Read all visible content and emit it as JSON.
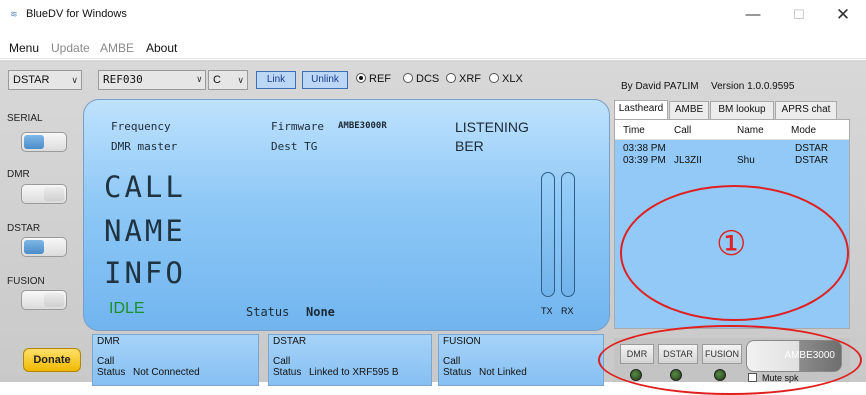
{
  "window": {
    "title": "BlueDV for Windows",
    "minimize": "—",
    "maximize": "☐",
    "close": "✕"
  },
  "menu": [
    "Menu",
    "Update",
    "AMBE",
    "About"
  ],
  "toolbar": {
    "mode_select": "DSTAR",
    "reflector_select": "REF030",
    "module_select": "C",
    "link_label": "Link",
    "unlink_label": "Unlink",
    "radios": [
      {
        "label": "REF",
        "selected": true
      },
      {
        "label": "DCS",
        "selected": false
      },
      {
        "label": "XRF",
        "selected": false
      },
      {
        "label": "XLX",
        "selected": false
      }
    ],
    "author": "By David PA7LIM",
    "version": "Version 1.0.0.9595"
  },
  "modes": [
    {
      "label": "SERIAL",
      "on": true
    },
    {
      "label": "DMR",
      "on": false
    },
    {
      "label": "DSTAR",
      "on": true
    },
    {
      "label": "FUSION",
      "on": false
    }
  ],
  "lcd": {
    "frequency_label": "Frequency",
    "dmr_master_label": "DMR master",
    "firmware_label": "Firmware",
    "firmware_value": "AMBE3000R",
    "dest_tg_label": "Dest TG",
    "listening": "LISTENING",
    "ber": "BER",
    "call": "CALL",
    "name": "NAME",
    "info": "INFO",
    "state": "IDLE",
    "status_label": "Status",
    "status_value": "None",
    "tx": "TX",
    "rx": "RX"
  },
  "bottom_panels": [
    {
      "title": "DMR",
      "call_label": "Call",
      "status_label": "Status",
      "status_value": "Not Connected"
    },
    {
      "title": "DSTAR",
      "call_label": "Call",
      "status_label": "Status",
      "status_value": "Linked to XRF595 B"
    },
    {
      "title": "FUSION",
      "call_label": "Call",
      "status_label": "Status",
      "status_value": "Not Linked"
    }
  ],
  "donate_label": "Donate",
  "tabs": [
    "Lastheard",
    "AMBE",
    "BM lookup",
    "APRS chat"
  ],
  "lastheard": {
    "columns": [
      "Time",
      "Call",
      "Name",
      "Mode"
    ],
    "rows": [
      {
        "time": "03:38 PM",
        "call": "",
        "name": "",
        "mode": "DSTAR"
      },
      {
        "time": "03:39 PM",
        "call": "JL3ZII",
        "name": "Shu",
        "mode": "DSTAR"
      }
    ]
  },
  "ambe_panel": {
    "buttons": [
      "DMR",
      "DSTAR",
      "FUSION"
    ],
    "device_label": "AMBE3000",
    "mute_label": "Mute spk"
  },
  "annotation_number": "①",
  "colors": {
    "lcd": "#8ec8f6",
    "idle": "#1d8f2a",
    "accent_ring": "#e02020"
  }
}
